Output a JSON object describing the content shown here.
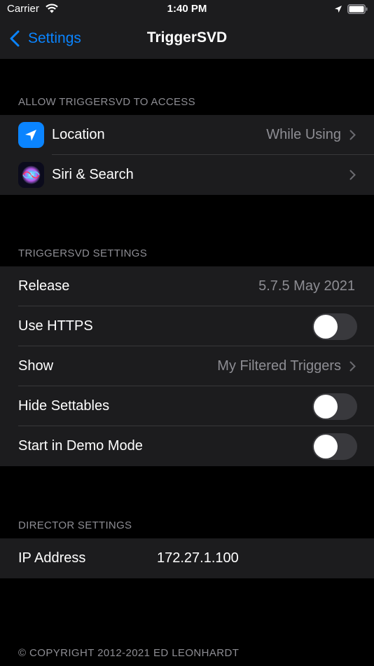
{
  "status": {
    "carrier": "Carrier",
    "time": "1:40 PM"
  },
  "nav": {
    "back_label": "Settings",
    "title": "TriggerSVD"
  },
  "access": {
    "header": "ALLOW TRIGGERSVD TO ACCESS",
    "location": {
      "label": "Location",
      "value": "While Using",
      "icon": "location-arrow-icon",
      "color": "#0a84ff"
    },
    "siri": {
      "label": "Siri & Search",
      "icon": "siri-icon"
    }
  },
  "settings": {
    "header": "TRIGGERSVD SETTINGS",
    "release": {
      "label": "Release",
      "value": "5.7.5 May 2021"
    },
    "https": {
      "label": "Use HTTPS",
      "on": false
    },
    "show": {
      "label": "Show",
      "value": "My Filtered Triggers"
    },
    "hide_settables": {
      "label": "Hide Settables",
      "on": false
    },
    "demo": {
      "label": "Start in Demo Mode",
      "on": false
    }
  },
  "director": {
    "header": "DIRECTOR SETTINGS",
    "ip": {
      "label": "IP Address",
      "value": "172.27.1.100"
    }
  },
  "footer": "© COPYRIGHT 2012-2021 ED LEONHARDT"
}
